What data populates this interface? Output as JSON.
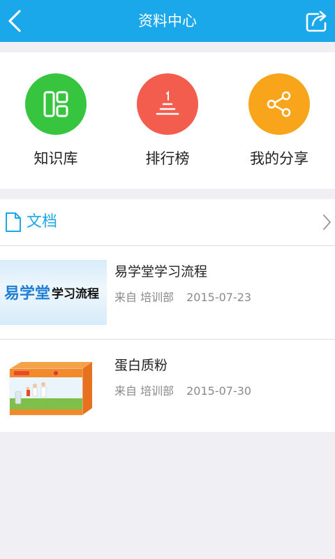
{
  "header": {
    "title": "资料中心",
    "bg_color": "#1aa8ea",
    "back_icon": "chevron-left-icon",
    "share_icon": "share-export-icon"
  },
  "quick_actions": [
    {
      "label": "知识库",
      "icon": "knowledge-grid-icon",
      "color": "#37c540"
    },
    {
      "label": "排行榜",
      "icon": "ranking-stack-icon",
      "color": "#f35d4e"
    },
    {
      "label": "我的分享",
      "icon": "share-nodes-icon",
      "color": "#f8a51b"
    }
  ],
  "docs": {
    "title": "文档",
    "accent_color": "#1aa8ea",
    "items": [
      {
        "title": "易学堂学习流程",
        "source": "来自 培训部",
        "date": "2015-07-23",
        "thumb_brand": "易学堂",
        "thumb_sub": "学习流程"
      },
      {
        "title": "蛋白质粉",
        "source": "来自 培训部",
        "date": "2015-07-30"
      }
    ]
  }
}
